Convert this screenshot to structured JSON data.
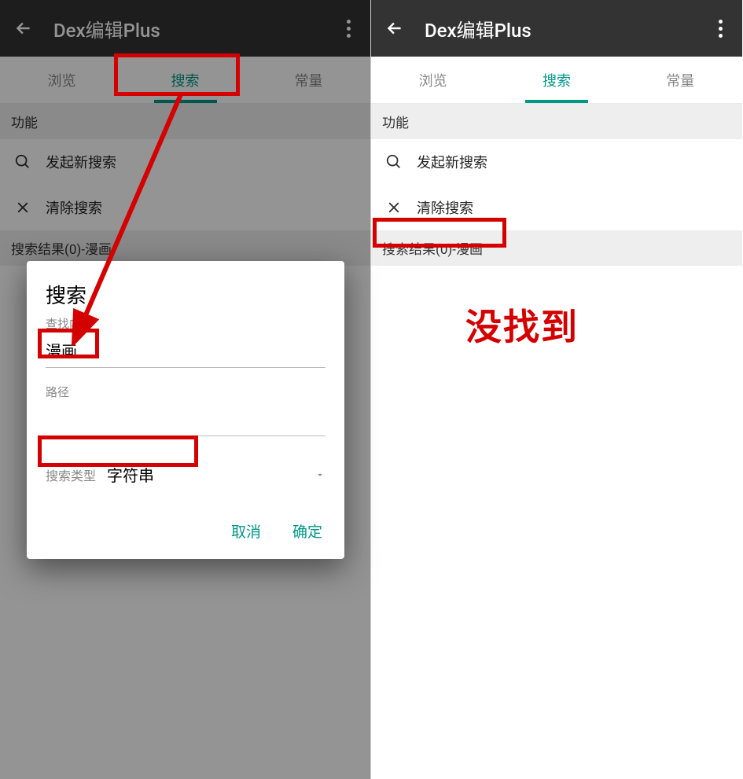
{
  "app": {
    "title": "Dex编辑Plus"
  },
  "tabs": {
    "browse": "浏览",
    "search": "搜索",
    "const": "常量"
  },
  "sections": {
    "func": "功能",
    "results": "搜索结果(0)-漫画"
  },
  "items": {
    "new_search": "发起新搜索",
    "clear_search": "清除搜索"
  },
  "dialog": {
    "title": "搜索",
    "content_hint": "查找内容",
    "content_value": "漫画",
    "path_hint": "路径",
    "path_value": "",
    "type_label": "搜索类型",
    "type_value": "字符串",
    "cancel": "取消",
    "ok": "确定"
  },
  "annotation": {
    "not_found": "没找到"
  }
}
